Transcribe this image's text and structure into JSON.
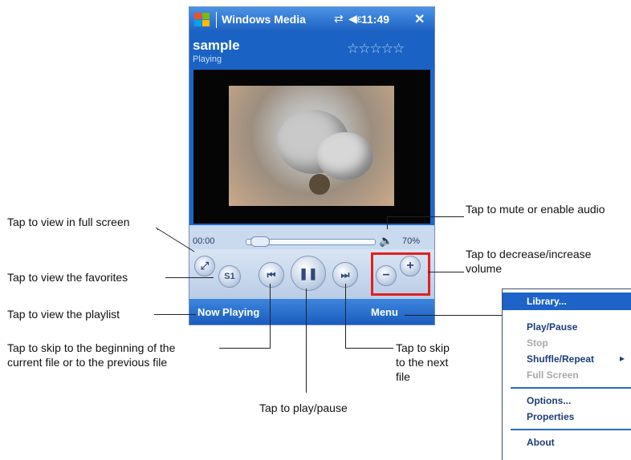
{
  "device": {
    "app_title": "Windows Media",
    "clock": "11:49",
    "close_label": "✕",
    "song_title": "sample",
    "status": "Playing",
    "rating_stars": "☆☆☆☆☆",
    "time_elapsed": "00:00",
    "volume_percent": "70%",
    "volume_level": 0.7,
    "softkey_left": "Now Playing",
    "softkey_right": "Menu",
    "controls": {
      "fullscreen": "⤢",
      "favorites": "S1",
      "previous": "⏮",
      "play_pause": "❚❚",
      "next": "⏭",
      "volume_down": "−",
      "volume_up": "+"
    },
    "highlight_color": "#e02020"
  },
  "callouts": {
    "fullscreen": "Tap to view in full screen",
    "favorites": "Tap to view the favorites",
    "playlist": "Tap to view the playlist",
    "previous_line1": "Tap to skip to the beginning of the",
    "previous_line2": "current file or to the previous file",
    "play_pause": "Tap to play/pause",
    "next_line1": "Tap to skip",
    "next_line2": "to the next",
    "next_line3": "file",
    "mute": "Tap to mute or enable audio",
    "volume_line1": "Tap to decrease/increase",
    "volume_line2": "volume"
  },
  "menu": {
    "items": [
      "Library...",
      "Play/Pause",
      "Stop",
      "Shuffle/Repeat",
      "Full Screen",
      "Options...",
      "Properties",
      "About"
    ],
    "submenu_arrow": "▸"
  }
}
